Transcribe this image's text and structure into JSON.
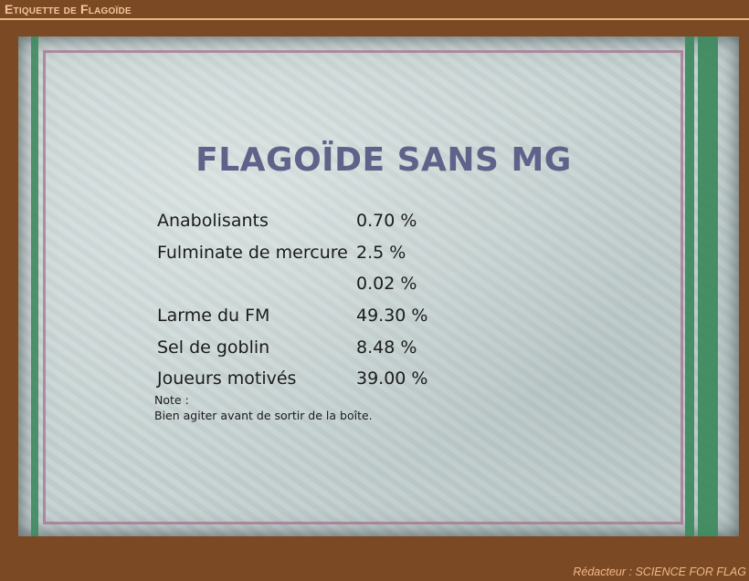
{
  "window": {
    "title": "Etiquette de Flagoïde"
  },
  "label": {
    "heading": "FLAGOÏDE SANS MG",
    "ingredients": [
      {
        "name": "Anabolisants",
        "value": "0.70 %"
      },
      {
        "name": "Fulminate de mercure",
        "value": "2.5 %"
      },
      {
        "name": "",
        "value": "0.02 %"
      },
      {
        "name": "Larme du FM",
        "value": "49.30 %"
      },
      {
        "name": "Sel de goblin",
        "value": "8.48 %"
      },
      {
        "name": "Joueurs motivés",
        "value": "39.00 %"
      }
    ],
    "note_title": "Note :",
    "note_text": "Bien agiter avant de sortir de la boîte."
  },
  "footer": {
    "author": "Rédacteur : SCIENCE FOR FLAG"
  },
  "colors": {
    "background": "#7b4a24",
    "title_text": "#f2c79a",
    "heading": "#5f6289",
    "stripe_green": "#3f8a60",
    "frame_pink": "#a77190",
    "paper": "#c6d3d2"
  }
}
